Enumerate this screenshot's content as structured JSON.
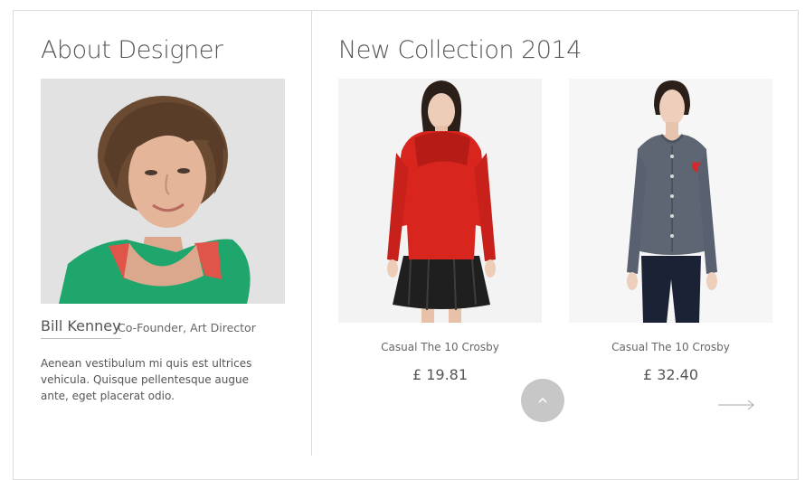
{
  "about": {
    "title": "About Designer",
    "designer_name": "Bill Kenney",
    "designer_role": "Co-Founder, Art Director",
    "bio": "Aenean vestibulum mi quis est ultrices vehicula. Quisque pellentesque augue ante, eget placerat odio."
  },
  "collection": {
    "title": "New Collection 2014",
    "products": [
      {
        "name": "Casual The 10 Crosby",
        "price": "£ 19.81"
      },
      {
        "name": "Casual The 10 Crosby",
        "price": "£ 32.40"
      }
    ]
  },
  "icons": {
    "scroll_top": "chevron-up-icon",
    "next": "arrow-right-icon"
  },
  "colors": {
    "text": "#555555",
    "border": "#dcdcdc",
    "scroll_button": "#c7c7c7",
    "jacket_red": "#d8261f",
    "cardigan_grey": "#5f6673"
  }
}
